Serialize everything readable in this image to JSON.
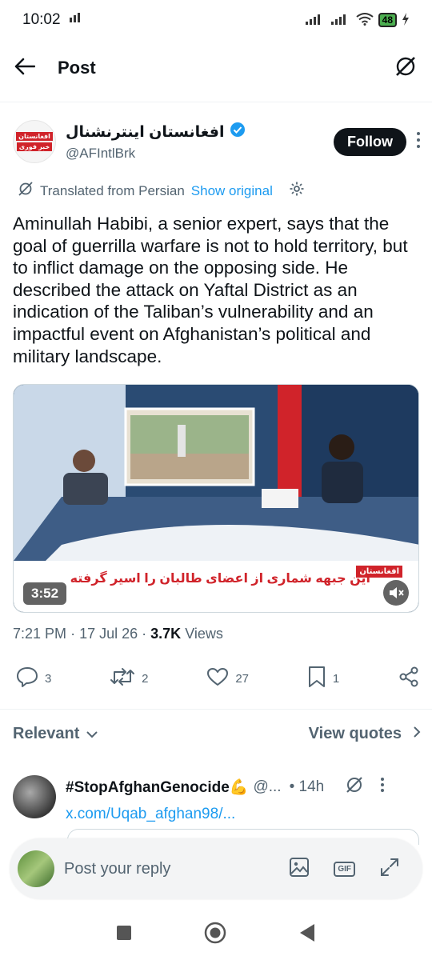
{
  "status_bar": {
    "time": "10:02",
    "battery": "48"
  },
  "header": {
    "title": "Post"
  },
  "author": {
    "name": "افغانستان اینترنشنال",
    "handle": "@AFIntlBrk",
    "avatar_line1": "افغانستان",
    "avatar_line2": "خبر فوری",
    "follow_label": "Follow"
  },
  "translation": {
    "label": "Translated from Persian",
    "show_original": "Show original"
  },
  "tweet": {
    "text": "Aminullah Habibi, a senior expert, says that the goal of guerrilla warfare is not to hold territory, but to inflict damage on the opposing side. He described the attack on Yaftal District as an indication of the Taliban’s vulnerability and an impactful event on Afghanistan’s political and military landscape."
  },
  "media": {
    "duration": "3:52",
    "caption": "این جبهه شماری از اعضای طالبان را اسیر گرفته",
    "logo_text": "افغانستان"
  },
  "meta": {
    "time": "7:21 PM",
    "date": "17 Jul 26",
    "views_count": "3.7K",
    "views_label": "Views"
  },
  "actions": {
    "replies": "3",
    "reposts": "2",
    "likes": "27",
    "bookmarks": "1"
  },
  "replies_section": {
    "sort_label": "Relevant",
    "view_quotes": "View quotes"
  },
  "reply": {
    "name": "#StopAfghanGenocide💪",
    "handle": "@...",
    "time": "• 14h",
    "link": "x.com/Uqab_afghan98/..."
  },
  "compose": {
    "placeholder": "Post your reply"
  },
  "colors": {
    "accent": "#1d9bf0",
    "text": "#0f1419",
    "muted": "#536471"
  }
}
